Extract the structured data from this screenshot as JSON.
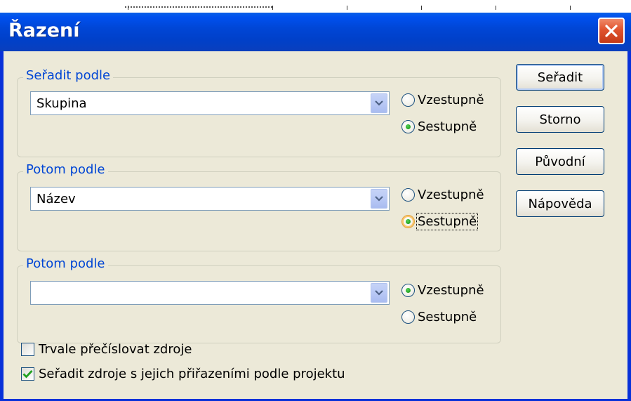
{
  "window": {
    "title": "Řazení"
  },
  "groups": [
    {
      "label": "Seřadit podle",
      "field_value": "Skupina",
      "ascending": "Vzestupně",
      "descending": "Sestupně",
      "selected": "descending"
    },
    {
      "label": "Potom podle",
      "field_value": "Název",
      "ascending": "Vzestupně",
      "descending": "Sestupně",
      "selected": "descending"
    },
    {
      "label": "Potom podle",
      "field_value": "",
      "ascending": "Vzestupně",
      "descending": "Sestupně",
      "selected": "ascending"
    }
  ],
  "checkboxes": [
    {
      "label": "Trvale přečíslovat zdroje",
      "checked": false
    },
    {
      "label": "Seřadit zdroje s jejich přiřazeními podle projektu",
      "checked": true
    }
  ],
  "buttons": {
    "sort": "Seřadit",
    "cancel": "Storno",
    "reset": "Původní",
    "help": "Nápověda"
  },
  "colors": {
    "title_bar": "#0046d6",
    "dialog_bg": "#ece9d8",
    "group_label": "#0046d5",
    "close_button": "#e0532e"
  }
}
